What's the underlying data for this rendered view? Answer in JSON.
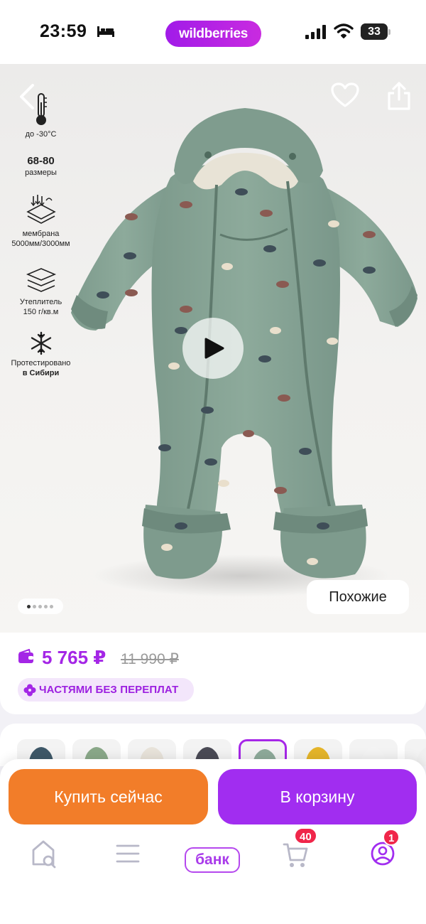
{
  "status_bar": {
    "time": "23:59",
    "brand": "wildberries",
    "battery_level": "33",
    "icons": [
      "bed-icon",
      "signal-icon",
      "wifi-icon",
      "battery-icon"
    ]
  },
  "hero": {
    "icons": [
      "back-arrow-icon",
      "heart-icon",
      "share-icon",
      "play-icon"
    ],
    "features": [
      {
        "icon": "thermometer-icon",
        "line1": "до -30°С",
        "line2": ""
      },
      {
        "icon": "",
        "line1": "68-80",
        "line2": "размеры"
      },
      {
        "icon": "membrane-icon",
        "line1": "мембрана",
        "line2": "5000мм/3000мм"
      },
      {
        "icon": "layers-icon",
        "line1": "Утеплитель",
        "line2": "150 г/кв.м"
      },
      {
        "icon": "snowflake-icon",
        "line1": "Протестировано",
        "line2": "в Сибири"
      }
    ],
    "gallery": {
      "total": 5,
      "active": 1
    },
    "similar_label": "Похожие"
  },
  "price": {
    "current": "5 765 ₽",
    "old": "11 990 ₽",
    "installment": "ЧАСТЯМИ БЕЗ ПЕРЕПЛАТ",
    "icons": [
      "wallet-icon",
      "flower-icon"
    ]
  },
  "variants": {
    "selected_index": 4,
    "colors": [
      "#3e5868",
      "#8aa889",
      "#e8e3da",
      "#4a4a55",
      "#8eaa9a",
      "#e5b52a",
      "#f4f4f4",
      "#f0f0f0"
    ]
  },
  "actions": {
    "buy_now": "Купить сейчас",
    "add_to_cart": "В корзину"
  },
  "nav": {
    "items": [
      "home-search",
      "catalog",
      "bank",
      "cart",
      "profile"
    ],
    "bank_label": "банк",
    "cart_badge": "40",
    "profile_badge": "1"
  },
  "colors": {
    "brand_purple": "#a12df0",
    "orange": "#f27d29",
    "badge_red": "#f0264a"
  }
}
